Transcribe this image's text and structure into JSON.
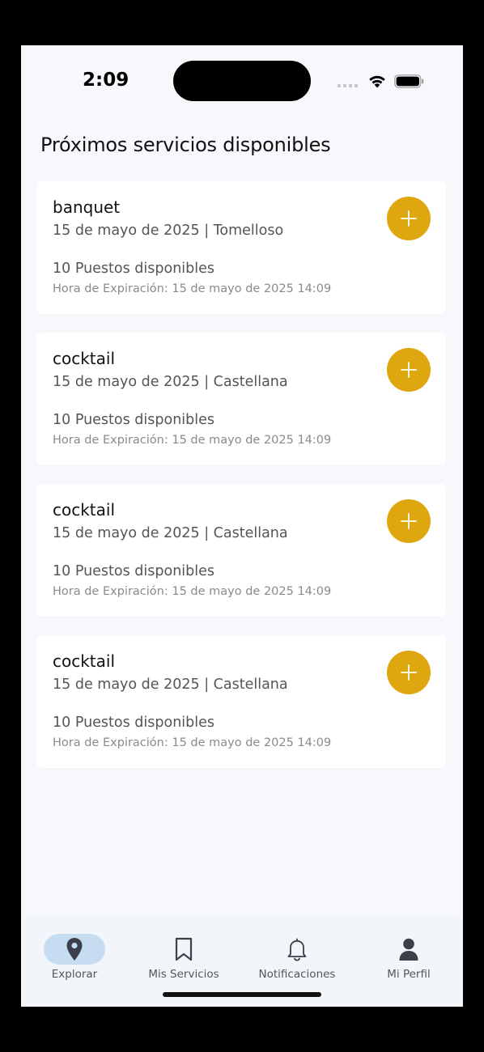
{
  "status_bar": {
    "time": "2:09"
  },
  "page_title": "Próximos servicios disponibles",
  "services": [
    {
      "name": "banquet",
      "date_location": "15 de mayo de 2025 | Tomelloso",
      "spots": "10 Puestos disponibles",
      "expiry": "Hora de Expiración: 15 de mayo de 2025 14:09"
    },
    {
      "name": "cocktail",
      "date_location": "15 de mayo de 2025 | Castellana",
      "spots": "10 Puestos disponibles",
      "expiry": "Hora de Expiración: 15 de mayo de 2025 14:09"
    },
    {
      "name": "cocktail",
      "date_location": "15 de mayo de 2025 | Castellana",
      "spots": "10 Puestos disponibles",
      "expiry": "Hora de Expiración: 15 de mayo de 2025 14:09"
    },
    {
      "name": "cocktail",
      "date_location": "15 de mayo de 2025 | Castellana",
      "spots": "10 Puestos disponibles",
      "expiry": "Hora de Expiración: 15 de mayo de 2025 14:09"
    }
  ],
  "tab_bar": {
    "tabs": [
      {
        "label": "Explorar",
        "icon": "map-pin-icon",
        "active": true
      },
      {
        "label": "Mis Servicios",
        "icon": "bookmark-icon",
        "active": false
      },
      {
        "label": "Notificaciones",
        "icon": "bell-icon",
        "active": false
      },
      {
        "label": "Mi Perfil",
        "icon": "user-icon",
        "active": false
      }
    ]
  },
  "colors": {
    "accent": "#dea60f",
    "active_tab_bg": "#c6dcf0",
    "background": "#f6f8fb"
  }
}
